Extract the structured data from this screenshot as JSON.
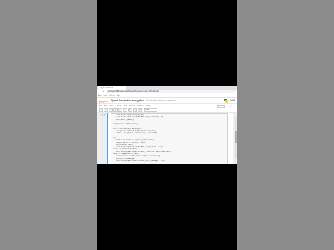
{
  "browser": {
    "tab_title": "Jupyter Notebook",
    "url": "localhost:8888/notebooks/Speech Recognition using python.ipynb",
    "bookmarks": [
      "Apps",
      "Gmail",
      "YouTube",
      "Maps"
    ]
  },
  "jupyter": {
    "logo": "jupyter",
    "title": "Speech Recognition using python",
    "checkpoint": "Last Checkpoint: 3 minutes ago (autosaved)",
    "logout": "Logout",
    "menus": [
      "File",
      "Edit",
      "View",
      "Insert",
      "Cell",
      "Kernel",
      "Widgets",
      "Help"
    ],
    "trusted": "Trusted",
    "kernel": "Python 3",
    "toolbar": [
      "+",
      "✂",
      "⧉",
      "▤",
      "↑",
      "↓",
      "▶",
      "■",
      "↻"
    ],
    "cell_type": "Code"
  },
  "cell": {
    "prompt": "In [ ]:",
    "lines": [
      "    self.text_widget.pack(pady=10)",
      "    self.text_widget.insert(tk.END, \"Say something...\")",
      "    self.start_speech()",
      "",
      "recognizer = sr.Recognizer()",
      "",
      "with sr.Microphone() as source:",
      "    recognizer.adjust_for_ambient_noise(source)",
      "    audio = recognizer.listen(source, timeout=5)",
      "",
      "try:",
      "    text = recognizer.recognize_google(audio)",
      "    output_text = f\"You said: {text}\"",
      "    print(output_text)",
      "    self.text_widget.insert(tk.END, output_text + \"\\n\")",
      "except sr.UnknownValueError:",
      "    self.text_widget.insert(tk.END, \"Could not understand audio\")",
      "except sr.RequestError as e:",
      "    error_message = f\"Could not request results; {e}\"",
      "    print(error_message)",
      "    self.text_widget.insert(tk.END, error_message + \"\\n\")"
    ]
  }
}
